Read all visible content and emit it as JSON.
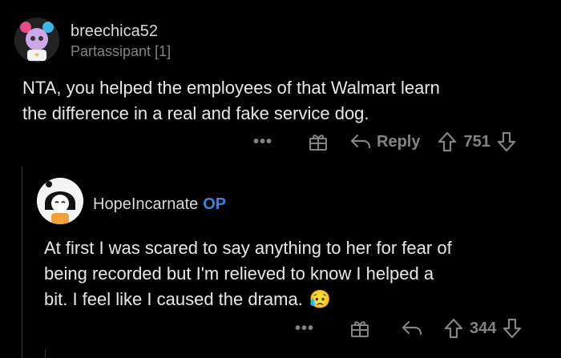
{
  "comments": [
    {
      "username": "breechica52",
      "flair": "Partassipant [1]",
      "body_lines": [
        "NTA, you helped the employees of that Walmart learn",
        "the difference in a real and fake service dog."
      ],
      "actions": {
        "more": "•••",
        "reply_label": "Reply",
        "score": "751"
      },
      "icons": [
        "more-icon",
        "gift-icon",
        "reply-icon",
        "upvote-icon",
        "downvote-icon"
      ]
    },
    {
      "username": "HopeIncarnate",
      "op_badge": "OP",
      "body_lines": [
        "At first I was scared to say anything to her for fear of",
        "being recorded but I'm relieved to know I helped a",
        "bit. I feel like I caused the drama."
      ],
      "emoji": "😥",
      "actions": {
        "more": "•••",
        "score": "344"
      },
      "icons": [
        "more-icon",
        "gift-icon",
        "reply-icon",
        "upvote-icon",
        "downvote-icon"
      ]
    }
  ],
  "colors": {
    "background": "#000000",
    "text": "#d7dadc",
    "muted": "#818384",
    "op": "#3a85d8"
  }
}
